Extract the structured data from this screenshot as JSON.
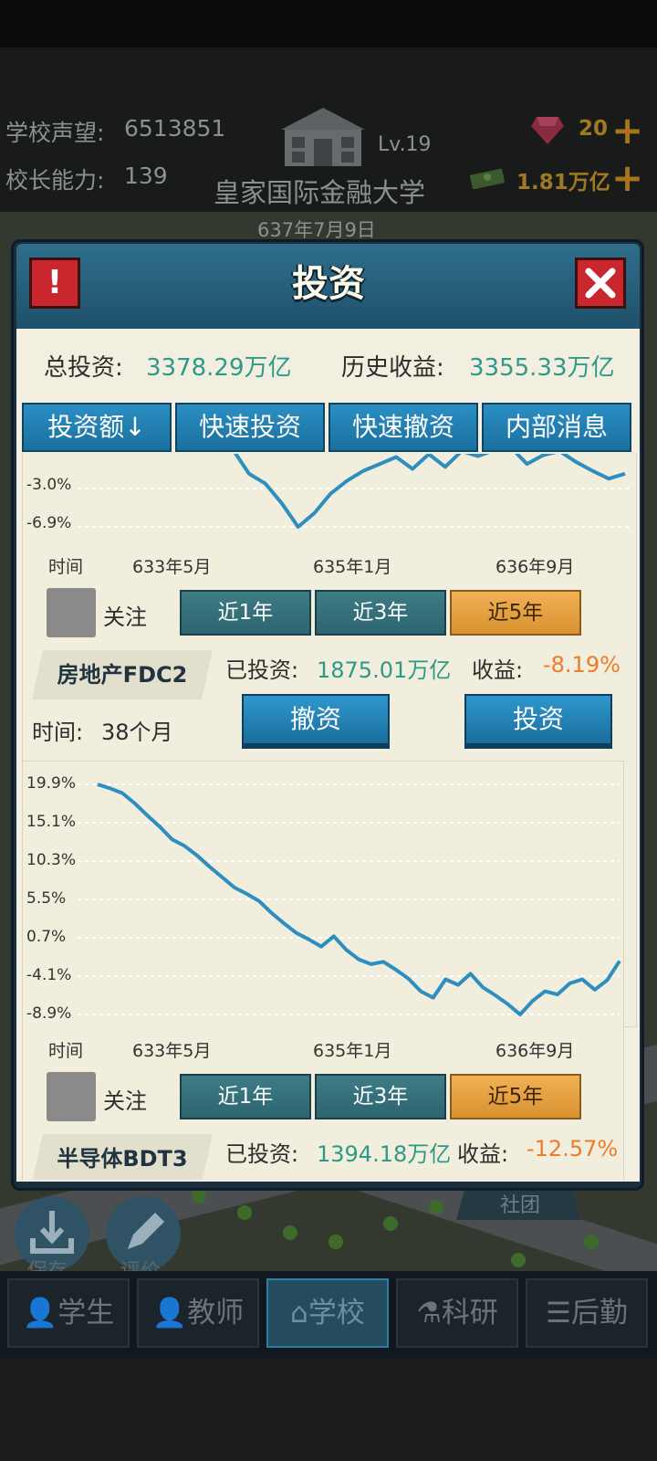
{
  "hud": {
    "reputation_label": "学校声望:",
    "reputation_value": "6513851",
    "ability_label": "校长能力:",
    "ability_value": "139",
    "level": "Lv.19",
    "school_name": "皇家国际金融大学",
    "date": "637年7月9日",
    "gems": "20",
    "money": "1.81万亿"
  },
  "dialog": {
    "title": "投资",
    "alert_icon": "!",
    "close_icon": "close-icon",
    "total_invest_label": "总投资:",
    "total_invest_value": "3378.29万亿",
    "history_profit_label": "历史收益:",
    "history_profit_value": "3355.33万亿",
    "tabs": [
      "投资额↓",
      "快速投资",
      "快速撤资",
      "内部消息"
    ]
  },
  "stocks": [
    {
      "y_ticks": [
        "-3.0%",
        "-6.9%"
      ],
      "x_title": "时间",
      "x_ticks": [
        "633年5月",
        "635年1月",
        "636年9月"
      ],
      "follow_label": "关注",
      "ranges": [
        "近1年",
        "近3年",
        "近5年"
      ],
      "active_range": "近5年",
      "name": "房地产FDC2",
      "invested_label": "已投资:",
      "invested_value": "1875.01万亿",
      "profit_label": "收益:",
      "profit_value": "-8.19%",
      "time_label": "时间:",
      "time_value": "38个月",
      "withdraw_button": "撤资",
      "invest_button": "投资"
    },
    {
      "y_ticks": [
        "19.9%",
        "15.1%",
        "10.3%",
        "5.5%",
        "0.7%",
        "-4.1%",
        "-8.9%"
      ],
      "x_title": "时间",
      "x_ticks": [
        "633年5月",
        "635年1月",
        "636年9月"
      ],
      "follow_label": "关注",
      "ranges": [
        "近1年",
        "近3年",
        "近5年"
      ],
      "active_range": "近5年",
      "name": "半导体BDT3",
      "invested_label": "已投资:",
      "invested_value": "1394.18万亿",
      "profit_label": "收益:",
      "profit_value": "-12.57%"
    }
  ],
  "scene": {
    "club_label": "社团",
    "save_label": "保存",
    "review_label": "评价"
  },
  "nav": [
    "学生",
    "教师",
    "学校",
    "科研",
    "后勤"
  ],
  "nav_active": "学校",
  "colors": {
    "line": "#2f8ec0",
    "gain_green": "#2c9a87",
    "loss_orange": "#ee7a2b",
    "active_range": "#e6a140"
  },
  "chart_data": [
    {
      "type": "line",
      "xlabel": "时间",
      "x_ticks": [
        "633年5月",
        "635年1月",
        "636年9月"
      ],
      "y_ticks": [
        "-3.0%",
        "-6.9%"
      ],
      "note": "partially visible, top clipped",
      "series": [
        {
          "values": [
            1.0,
            -1.5,
            -2.5,
            -4.5,
            -6.9,
            -5.5,
            -3.5,
            -2.2,
            -1.2,
            -0.5,
            0.2,
            -1.0,
            0.5,
            -0.8,
            0.8,
            0.3,
            0.9,
            1.2,
            -0.5,
            0.4,
            0.8,
            -0.3,
            -1.2,
            -2.0,
            -1.5
          ]
        }
      ]
    },
    {
      "type": "line",
      "xlabel": "时间",
      "x_ticks": [
        "633年5月",
        "635年1月",
        "636年9月"
      ],
      "y_ticks": [
        "19.9%",
        "15.1%",
        "10.3%",
        "5.5%",
        "0.7%",
        "-4.1%",
        "-8.9%"
      ],
      "ylim": [
        -8.9,
        19.9
      ],
      "series": [
        {
          "values": [
            19.9,
            19.4,
            18.8,
            17.5,
            16.0,
            14.6,
            13.0,
            12.2,
            11.0,
            9.6,
            8.3,
            7.0,
            6.2,
            5.3,
            3.8,
            2.5,
            1.3,
            0.5,
            -0.4,
            0.9,
            -0.8,
            -2.0,
            -2.6,
            -2.3,
            -3.3,
            -4.4,
            -6.0,
            -6.8,
            -4.5,
            -5.2,
            -3.8,
            -5.5,
            -6.5,
            -7.6,
            -8.9,
            -7.2,
            -6.0,
            -6.4,
            -5.0,
            -4.5,
            -5.8,
            -4.6,
            -2.2
          ]
        }
      ]
    }
  ]
}
